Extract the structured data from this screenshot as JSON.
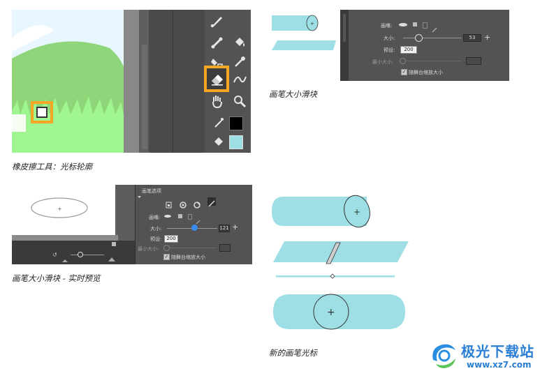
{
  "captions": {
    "eraser_tool": "橡皮擦工具：光标轮廓",
    "brush_size_slider": "画笔大小滑块",
    "brush_size_live_preview": "画笔大小滑块 - 实时预览",
    "new_brush_cursor": "新的画笔光标"
  },
  "brush_panel_small": {
    "stroke_label": "画嘴:",
    "size_label": "大小:",
    "size_value": "53",
    "preset_label": "预设:",
    "preset_value": "200",
    "min_size_label": "最小大小:",
    "scale_label": "随舞台缩放大小",
    "scale_checked": true
  },
  "brush_panel_large": {
    "header": "画笔选项",
    "stroke_label": "画嘴:",
    "size_label": "大小:",
    "size_value": "121",
    "preset_label": "预设:",
    "preset_value": "200",
    "min_size_label": "最小大小:",
    "scale_label": "随舞台缩放大小",
    "scale_checked": true
  },
  "watermark": {
    "title": "极光下载站",
    "url": "www.xz7.com"
  },
  "colors": {
    "stroke_color": "#000000",
    "fill_color": "#9edfe6",
    "highlight": "#f5a623",
    "panel_bg": "#535353",
    "brush_shape": "#9edfe6",
    "slider_blue": "#3b8ded"
  },
  "icons": [
    "brush-icon",
    "bone-icon",
    "paint-bucket-icon",
    "ink-bottle-icon",
    "eyedropper-icon",
    "eraser-icon",
    "width-icon",
    "hand-icon",
    "zoom-icon",
    "stroke-color-icon",
    "fill-color-icon"
  ]
}
